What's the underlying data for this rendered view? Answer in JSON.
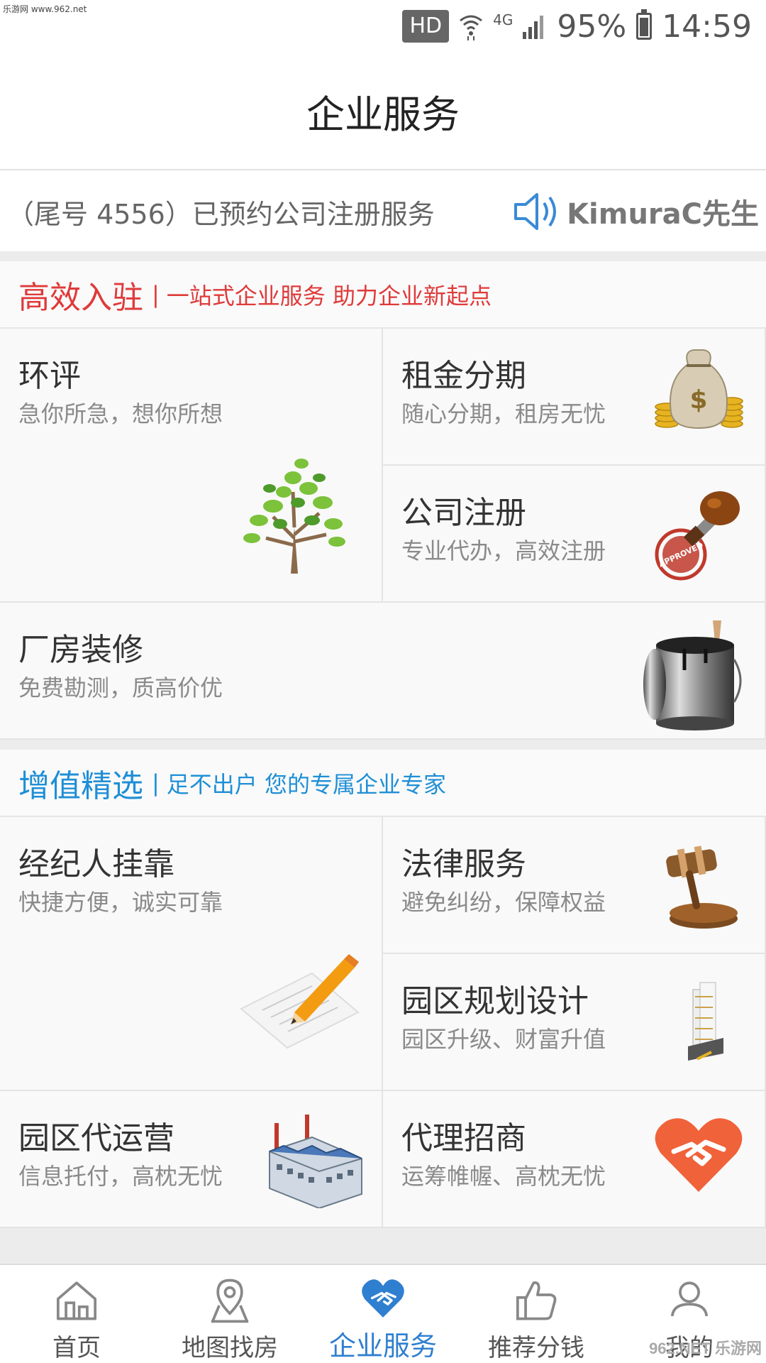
{
  "watermark_top": "乐游网 www.962.net",
  "status_bar": {
    "hd": "HD",
    "network": "4G",
    "battery": "95%",
    "battery_level": 0.95,
    "time": "14:59"
  },
  "header": {
    "title": "企业服务"
  },
  "notice": {
    "text": "（尾号 4556）已预约公司注册服务",
    "user": "KimuraC先生"
  },
  "sections": [
    {
      "title": "高效入驻",
      "separator": "|",
      "subtitle": "一站式企业服务 助力企业新起点",
      "color": "#e03a3a",
      "cards": [
        {
          "title": "环评",
          "subtitle": "急你所急，想你所想",
          "icon": "tree-icon"
        },
        {
          "title": "租金分期",
          "subtitle": "随心分期，租房无忧",
          "icon": "money-bag-icon"
        },
        {
          "title": "公司注册",
          "subtitle": "专业代办，高效注册",
          "icon": "approved-stamp-icon",
          "stamp_text": "APPROVED"
        },
        {
          "title": "厂房装修",
          "subtitle": "免费勘测，质高价优",
          "icon": "paint-bucket-icon"
        }
      ]
    },
    {
      "title": "增值精选",
      "separator": "|",
      "subtitle": "足不出户 您的专属企业专家",
      "color": "#1f8fd6",
      "cards": [
        {
          "title": "经纪人挂靠",
          "subtitle": "快捷方便，诚实可靠",
          "icon": "pencil-paper-icon"
        },
        {
          "title": "法律服务",
          "subtitle": "避免纠纷，保障权益",
          "icon": "gavel-icon"
        },
        {
          "title": "园区规划设计",
          "subtitle": "园区升级、财富升值",
          "icon": "buildings-icon"
        },
        {
          "title": "园区代运营",
          "subtitle": "信息托付，高枕无忧",
          "icon": "factory-icon"
        },
        {
          "title": "代理招商",
          "subtitle": "运筹帷幄、高枕无忧",
          "icon": "heart-handshake-icon"
        }
      ]
    }
  ],
  "bottom_nav": {
    "items": [
      {
        "label": "首页",
        "icon": "home-icon"
      },
      {
        "label": "地图找房",
        "icon": "map-pin-icon"
      },
      {
        "label": "企业服务",
        "icon": "handshake-icon",
        "active": true
      },
      {
        "label": "推荐分钱",
        "icon": "thumbs-up-icon"
      },
      {
        "label": "我的",
        "icon": "user-icon"
      }
    ],
    "active_color": "#2f7fd0"
  },
  "watermark_bottom": "962.NET 乐游网"
}
